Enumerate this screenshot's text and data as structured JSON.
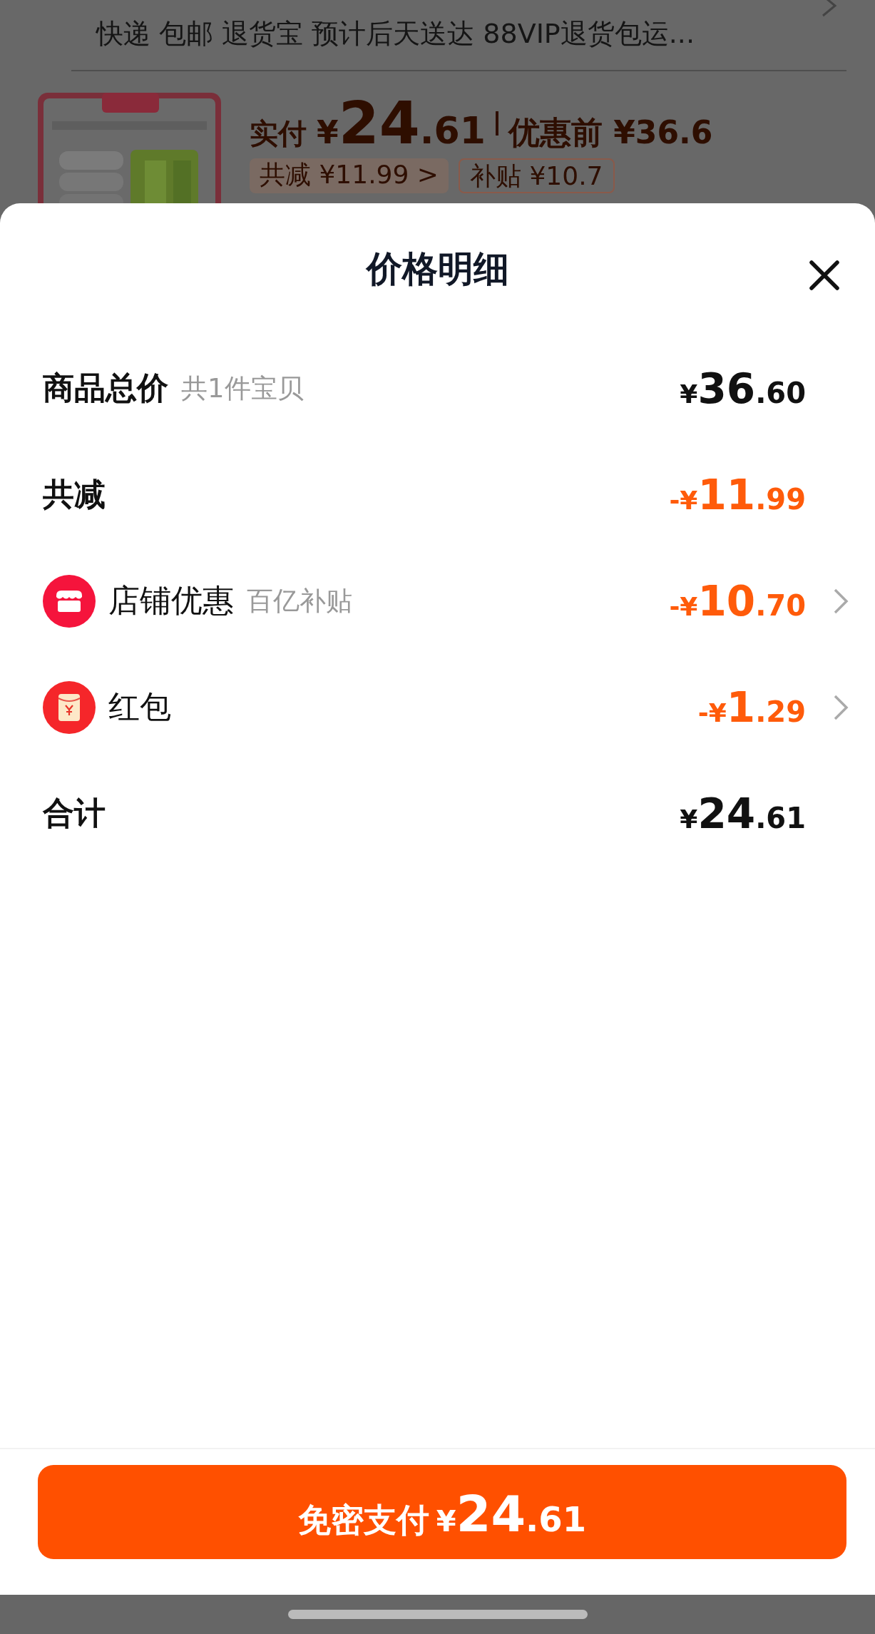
{
  "background_page": {
    "delivery_info": "快递 包邮 退货宝 预计后天送达 88VIP退货包运...",
    "product": {
      "paid_label": "实付",
      "paid_amount": "¥24.61",
      "before_discount": "优惠前 ¥36.6",
      "tags": [
        {
          "text": "共减 ¥11.99 >",
          "kind": "filled"
        },
        {
          "text": "补贴 ¥10.7",
          "kind": "outlined"
        }
      ]
    }
  },
  "sheet": {
    "title": "价格明细",
    "rows": [
      {
        "kind": "sum",
        "label": "商品总价",
        "note": "共1件宝贝",
        "amount": "¥36.60"
      },
      {
        "kind": "reduction",
        "label": "共减",
        "amount": "-¥11.99"
      },
      {
        "kind": "store_discount",
        "label": "店铺优惠",
        "note": "百亿补贴",
        "amount": "-¥10.70"
      },
      {
        "kind": "red_packet",
        "label": "红包",
        "amount": "-¥1.29"
      },
      {
        "kind": "total",
        "label": "合计",
        "amount": "¥24.61"
      }
    ],
    "pay_button": {
      "label": "免密支付",
      "amount": "¥24.61"
    }
  }
}
